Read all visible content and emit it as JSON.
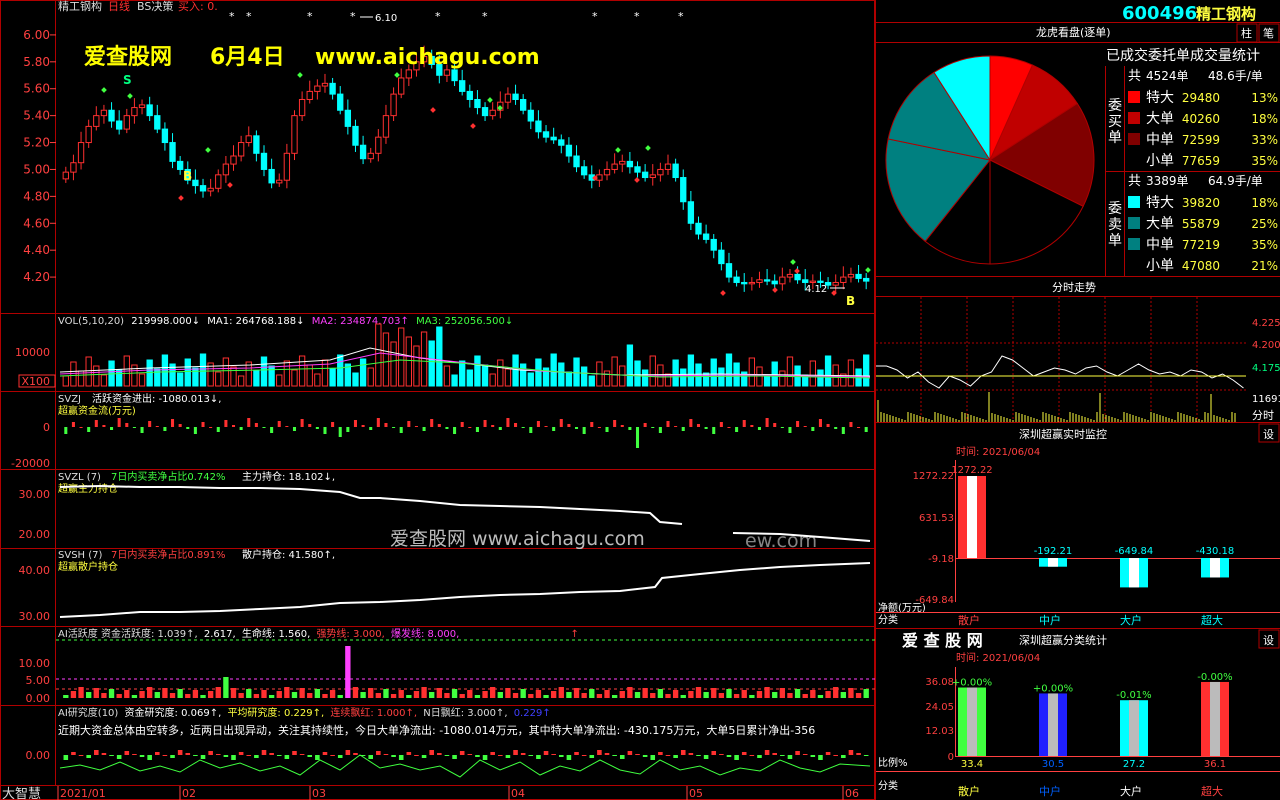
{
  "stock": {
    "code": "600496",
    "name": "精工钢构",
    "period": "日线",
    "indicator": "BS决策",
    "signal": "买入: 0."
  },
  "watermark": {
    "site": "爱查股网",
    "date": "6月4日",
    "url": "www.aichagu.com",
    "center": "爱查股网    www.aichagu.com",
    "center_tail": "ew.com"
  },
  "price_axis": {
    "ticks": [
      "6.00",
      "5.80",
      "5.60",
      "5.40",
      "5.20",
      "5.00",
      "4.80",
      "4.60",
      "4.40",
      "4.20"
    ],
    "high_label": "6.10",
    "low_label": "4.12"
  },
  "markers": {
    "s": "S",
    "b": "B",
    "star": "*"
  },
  "vol": {
    "title": "VOL(5,10,20)",
    "v": "219998.000↓",
    "ma1": "MA1: 264768.188↓",
    "ma2": "MA2: 234874.703↑",
    "ma3": "MA3: 252056.500↓",
    "ticks": [
      "10000",
      "X100"
    ]
  },
  "svzj": {
    "title": "SVZJ",
    "t1": "活跃资金进出: -1080.013↓,",
    "t2": "超赢资金流(万元)",
    "ticks": [
      "0",
      "-20000"
    ]
  },
  "svzl": {
    "title": "SVZL (7)",
    "t1": "7日内买卖净占比0.742%",
    "t2": "主力持仓: 18.102↓,",
    "t3": "超赢主力持仓",
    "ticks": [
      "30.00",
      "20.00"
    ]
  },
  "svsh": {
    "title": "SVSH (7)",
    "t1": "7日内买卖净占比0.891%",
    "t2": "散户持仓: 41.580↑,",
    "t3": "超赢散户持仓",
    "ticks": [
      "40.00",
      "30.00"
    ]
  },
  "ai_act": {
    "t1": "AI活跃度 资金活跃度: 1.039↑,",
    "t2": "2.617,",
    "t3": "生命线: 1.560,",
    "t4": "强势线: 3.000,",
    "t5": "爆发线: 8.000,",
    "t6": "↑",
    "ticks": [
      "10.00",
      "5.00",
      "0.00"
    ]
  },
  "ai_res": {
    "t1": "AI研究度(10)",
    "t2": "资金研究度: 0.069↑,",
    "t3": "平均研究度: 0.229↑,",
    "t4": "连续飘红: 1.000↑,",
    "t5": "N日飘红: 3.000↑,",
    "t6": "0.229↑",
    "t7": "近期大资金总体由空转多，近两日出现异动，关注其持续性，今日大单净流出: -1080.014万元，其中特大单净流出: -430.175万元，大单5日累计净出-356",
    "ticks": [
      "0.00"
    ]
  },
  "bottom": {
    "app": "大智慧",
    "dates": [
      "2021/01",
      "02",
      "03",
      "04",
      "05",
      "06"
    ]
  },
  "panel_title": {
    "code": "600496",
    "name": "精工钢构",
    "btn1": "柱",
    "btn2": "笔"
  },
  "lhb": {
    "title": "龙虎看盘(逐单)",
    "sub": "已成交委托单成交量统计",
    "buy_label": "委买单",
    "sell_label": "委卖单",
    "buy_total": {
      "a": "共",
      "b": "4524单",
      "c": "48.6手/单"
    },
    "sell_total": {
      "a": "共",
      "b": "3389单",
      "c": "64.9手/单"
    },
    "buy": [
      {
        "name": "特大",
        "v": "29480",
        "p": "13%",
        "color": "#ff0000"
      },
      {
        "name": "大单",
        "v": "40260",
        "p": "18%",
        "color": "#c00000"
      },
      {
        "name": "中单",
        "v": "72599",
        "p": "33%",
        "color": "#800000"
      },
      {
        "name": "小单",
        "v": "77659",
        "p": "35%",
        "color": "#000000"
      }
    ],
    "sell": [
      {
        "name": "特大",
        "v": "39820",
        "p": "18%",
        "color": "#00ffff"
      },
      {
        "name": "大单",
        "v": "55879",
        "p": "25%",
        "color": "#008080"
      },
      {
        "name": "中单",
        "v": "77219",
        "p": "35%",
        "color": "#008080"
      },
      {
        "name": "小单",
        "v": "47080",
        "p": "21%",
        "color": "#000000"
      }
    ]
  },
  "fenshi": {
    "title": "分时走势",
    "ticks": [
      "4.225",
      "4.200",
      "4.175",
      "11691"
    ],
    "unit": "分时"
  },
  "rt": {
    "title": "深圳超赢实时监控",
    "btn": "设",
    "time": "时间: 2021/06/04",
    "yticks": [
      "1272.22",
      "631.53",
      "-9.18",
      "-649.84"
    ],
    "vals": [
      "1272.22",
      "-192.21",
      "-649.84",
      "-430.18"
    ],
    "unit": "净额(万元)",
    "cat_label": "分类",
    "cats": [
      "散户",
      "中户",
      "大户",
      "超大"
    ]
  },
  "cls": {
    "logo": "爱 查 股 网",
    "title": "深圳超赢分类统计",
    "btn": "设",
    "time": "时间: 2021/06/04",
    "yticks": [
      "36.08",
      "24.05",
      "12.03",
      "0"
    ],
    "top": [
      "+0.00%",
      "+0.00%",
      "-0.01%",
      "-0.00%"
    ],
    "vals": [
      "33.4",
      "30.5",
      "27.2",
      "36.1"
    ],
    "unit": "比例%",
    "cat_label": "分类",
    "cats": [
      "散户",
      "中户",
      "大户",
      "超大"
    ]
  },
  "chart_data": {
    "type": "candlestick",
    "title": "精工钢构",
    "ylim": [
      4.0,
      6.2
    ],
    "x_labels": [
      "2021/01",
      "02",
      "03",
      "04",
      "05",
      "06"
    ],
    "closes": [
      4.98,
      5.05,
      5.2,
      5.32,
      5.4,
      5.44,
      5.36,
      5.3,
      5.4,
      5.46,
      5.48,
      5.4,
      5.3,
      5.2,
      5.06,
      5.0,
      4.92,
      4.88,
      4.84,
      4.86,
      4.96,
      5.04,
      5.1,
      5.2,
      5.25,
      5.12,
      5.0,
      4.9,
      4.92,
      5.12,
      5.4,
      5.52,
      5.58,
      5.62,
      5.64,
      5.56,
      5.44,
      5.32,
      5.18,
      5.08,
      5.12,
      5.24,
      5.4,
      5.56,
      5.68,
      5.74,
      5.8,
      5.84,
      5.78,
      5.7,
      5.74,
      5.66,
      5.58,
      5.52,
      5.46,
      5.4,
      5.44,
      5.5,
      5.56,
      5.52,
      5.44,
      5.36,
      5.28,
      5.24,
      5.22,
      5.18,
      5.1,
      5.02,
      4.96,
      4.92,
      4.96,
      5.0,
      5.04,
      5.06,
      5.02,
      4.98,
      4.94,
      4.96,
      5.0,
      5.04,
      4.94,
      4.76,
      4.6,
      4.52,
      4.48,
      4.4,
      4.3,
      4.2,
      4.16,
      4.15,
      4.16,
      4.18,
      4.17,
      4.15,
      4.2,
      4.22,
      4.18,
      4.16,
      4.17,
      4.16,
      4.14,
      4.16,
      4.2,
      4.22,
      4.19,
      4.17
    ]
  }
}
